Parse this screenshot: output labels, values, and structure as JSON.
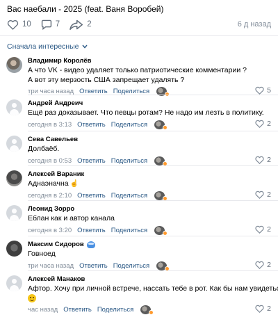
{
  "post": {
    "title": "Вас наебали - 2025 (feat. Ваня Воробей)",
    "likes": "10",
    "comments": "7",
    "shares": "2",
    "time": "6 д назад"
  },
  "sort": {
    "label": "Сначала интересные"
  },
  "actions": {
    "reply": "Ответить",
    "share": "Поделиться"
  },
  "comments": [
    {
      "author": "Владимир Королёв",
      "lines": [
        "А что VK - видео удаляет только патриотические комментарии ?",
        "А вот эту мерзость США запрещает удалять ?"
      ],
      "time": "три часа назад",
      "likes": "5",
      "avatar": "photo-a"
    },
    {
      "author": "Андрей Андреич",
      "lines": [
        "Ещё раз доказывает. Что певцы ротам? Не надо им лезть в политику."
      ],
      "time": "сегодня в 3:13",
      "likes": "2",
      "avatar": "gray"
    },
    {
      "author": "Сева Савельев",
      "lines": [
        "Долбаёб."
      ],
      "time": "сегодня в 0:53",
      "likes": "2",
      "avatar": "gray"
    },
    {
      "author": "Алексей Вараник",
      "lines": [
        "Аднаэначна"
      ],
      "time": "сегодня в 2:10",
      "likes": "2",
      "avatar": "photo-b"
    },
    {
      "author": "Леонид Зорро",
      "lines": [
        "Еблан как и автор канала"
      ],
      "time": "сегодня в 3:20",
      "likes": "2",
      "avatar": "gray"
    },
    {
      "author": "Максим Сидоров",
      "lines": [
        "Говноед"
      ],
      "time": "три часа назад",
      "likes": "2",
      "avatar": "photo-c"
    },
    {
      "author": "Алексей Манаков",
      "lines": [
        "Афтор. Хочу при личной встрече, нассать тебе в рот. Как бы нам увидеться?"
      ],
      "time": "час назад",
      "likes": "2",
      "avatar": "gray"
    }
  ],
  "colors": {
    "link": "#2a5885",
    "meta": "#818c99",
    "icon": "#626d7a"
  }
}
